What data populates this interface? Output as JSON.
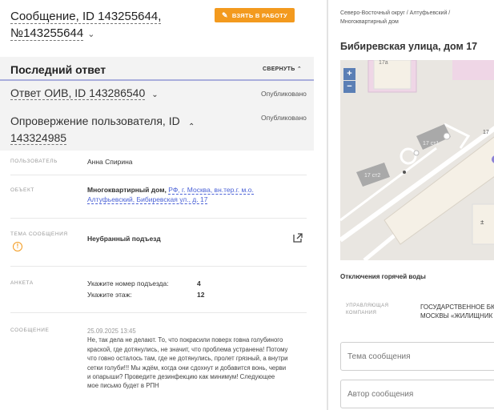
{
  "header": {
    "title_line1": "Сообщение, ID 143255644,",
    "title_line2": "№143255644",
    "take_button": "ВЗЯТЬ В РАБОТУ"
  },
  "last_answer": {
    "label": "Последний ответ",
    "collapse": "СВЕРНУТЬ"
  },
  "answers": {
    "oiv_title": "Ответ ОИВ, ID 143286540",
    "oiv_status": "Опубликовано",
    "refute_line1": "Опровержение пользователя, ID",
    "refute_line2": "143324985",
    "refute_status": "Опубликовано"
  },
  "details": {
    "user_label": "ПОЛЬЗОВАТЕЛЬ",
    "user_value": "Анна Спирина",
    "object_label": "ОБЪЕКТ",
    "object_type": "Многоквартирный дом,",
    "object_addr1": "РФ, г. Москва, вн.тер.г. м.о.",
    "object_addr2": "Алтуфьевский, Бибиревская ул., д. 17",
    "topic_label": "ТЕМА СООБЩЕНИЯ",
    "topic_value": "Неубранный подъезд",
    "survey_label": "АНКЕТА",
    "survey": [
      {
        "q": "Укажите номер подъезда:",
        "a": "4"
      },
      {
        "q": "Укажите этаж:",
        "a": "12"
      }
    ],
    "message_label": "СООБЩЕНИЕ",
    "message_date": "25.09.2025 13:45",
    "message_lines": [
      "Не, так дела не делают. То, что покрасили поверх говна голубиного",
      "краской, где дотянулись, не значит, что проблема устранена! Потому",
      "что говно осталось там, где не дотянулись, пролет грязный, а внутри",
      "сетки голуби!!! Мы ждём, когда они сдохнут и добавится вонь, черви",
      "и опарыши? Проведите дезинфекцию как минимум! Следующее",
      "мое письмо будет в РПН"
    ]
  },
  "right": {
    "breadcrumb_line1": "Северо-Восточный округ / Алтуфьевский /",
    "breadcrumb_line2": "Многоквартирный дом",
    "street": "Бибиревская улица, дом 17",
    "map_labels": [
      "17а",
      "17 ст1",
      "17 ст2",
      "17"
    ],
    "zoom_in": "+",
    "zoom_out": "−",
    "hot_water": "Отключения горячей воды",
    "uk_label_line1": "УПРАВЛЯЮЩАЯ",
    "uk_label_line2": "КОМПАНИЯ",
    "uk_value_line1": "ГОСУДАРСТВЕННОЕ БЮ",
    "uk_value_line2": "МОСКВЫ «ЖИЛИЩНИК",
    "topic_placeholder": "Тема сообщения",
    "author_placeholder": "Автор сообщения"
  },
  "colors": {
    "accent_orange": "#f39a1e",
    "link_blue": "#4a61d6",
    "map_building": "#f5f0e6",
    "map_purple": "#8a7fd6"
  }
}
